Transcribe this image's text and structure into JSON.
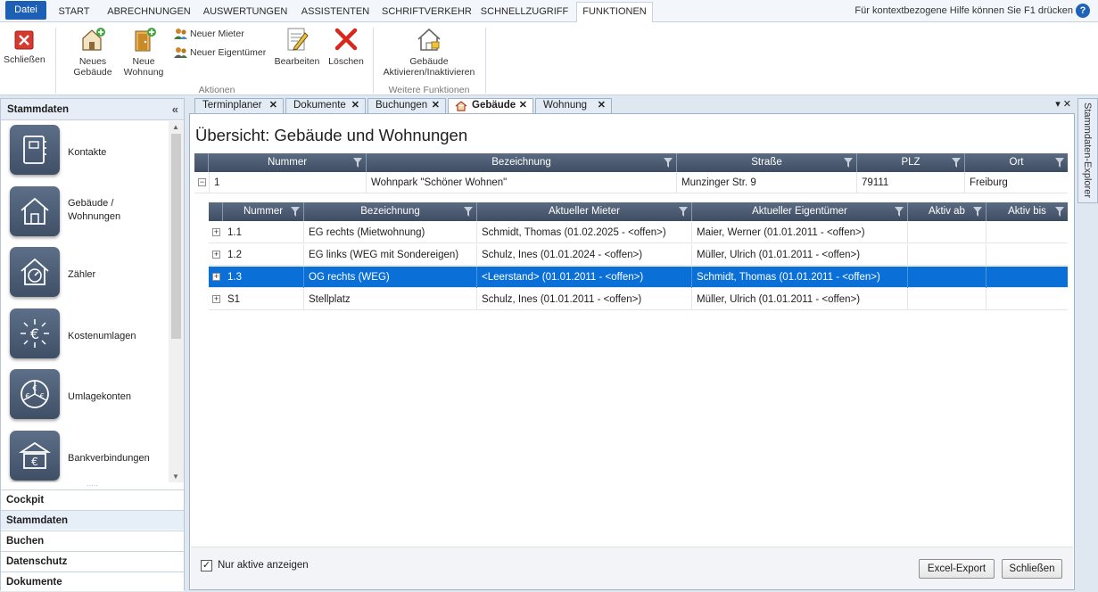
{
  "menu": {
    "tabs": [
      "Datei",
      "START",
      "ABRECHNUNGEN",
      "AUSWERTUNGEN",
      "ASSISTENTEN",
      "SCHRIFTVERKEHR",
      "SCHNELLZUGRIFF",
      "FUNKTIONEN"
    ],
    "active_tab": "FUNKTIONEN",
    "help_text": "Für kontextbezogene Hilfe können Sie F1 drücken",
    "help_icon": "help-icon"
  },
  "ribbon": {
    "close": "Schließen",
    "new_building": [
      "Neues",
      "Gebäude"
    ],
    "new_apartment": [
      "Neue",
      "Wohnung"
    ],
    "new_tenant": "Neuer Mieter",
    "new_owner": "Neuer Eigentümer",
    "edit": "Bearbeiten",
    "delete": "Löschen",
    "toggle_building": [
      "Gebäude",
      "Aktivieren/Inaktivieren"
    ],
    "group_actions": "Aktionen",
    "group_more": "Weitere Funktionen"
  },
  "sidebar": {
    "title": "Stammdaten",
    "items": [
      {
        "label": "Kontakte",
        "icon": "contacts-icon"
      },
      {
        "label": "Gebäude / Wohnungen",
        "icon": "house-icon"
      },
      {
        "label": "Zähler",
        "icon": "meter-icon"
      },
      {
        "label": "Kostenumlagen",
        "icon": "euro-distribution-icon"
      },
      {
        "label": "Umlagekonten",
        "icon": "euro-accounts-icon"
      },
      {
        "label": "Bankverbindungen",
        "icon": "bank-icon"
      }
    ],
    "nav": [
      "Cockpit",
      "Stammdaten",
      "Buchen",
      "Datenschutz",
      "Dokumente"
    ],
    "active_nav": "Stammdaten"
  },
  "tabs": [
    {
      "label": "Terminplaner"
    },
    {
      "label": "Dokumente"
    },
    {
      "label": "Buchungen"
    },
    {
      "label": "Gebäude",
      "active": true
    },
    {
      "label": "Wohnung"
    }
  ],
  "overview": {
    "title": "Übersicht: Gebäude und Wohnungen",
    "building_columns": [
      "Nummer",
      "Bezeichnung",
      "Straße",
      "PLZ",
      "Ort"
    ],
    "building": {
      "nummer": "1",
      "bezeichnung": "Wohnpark \"Schöner Wohnen\"",
      "strasse": "Munzinger Str. 9",
      "plz": "79111",
      "ort": "Freiburg"
    },
    "unit_columns": [
      "Nummer",
      "Bezeichnung",
      "Aktueller Mieter",
      "Aktueller Eigentümer",
      "Aktiv ab",
      "Aktiv bis"
    ],
    "units": [
      {
        "nummer": "1.1",
        "bezeichnung": "EG rechts (Mietwohnung)",
        "mieter": "Schmidt, Thomas (01.02.2025 - <offen>)",
        "eigentuemer": "Maier, Werner (01.01.2011 - <offen>)",
        "aktiv_ab": "",
        "aktiv_bis": ""
      },
      {
        "nummer": "1.2",
        "bezeichnung": "EG links (WEG mit Sondereigen)",
        "mieter": "Schulz, Ines (01.01.2024 - <offen>)",
        "eigentuemer": "Müller, Ulrich (01.01.2011 - <offen>)",
        "aktiv_ab": "",
        "aktiv_bis": ""
      },
      {
        "nummer": "1.3",
        "bezeichnung": "OG rechts (WEG)",
        "mieter": "<Leerstand> (01.01.2011 - <offen>)",
        "eigentuemer": "Schmidt, Thomas (01.01.2011 - <offen>)",
        "aktiv_ab": "",
        "aktiv_bis": "",
        "selected": true
      },
      {
        "nummer": "S1",
        "bezeichnung": "Stellplatz",
        "mieter": "Schulz, Ines (01.01.2011 - <offen>)",
        "eigentuemer": "Müller, Ulrich (01.01.2011 - <offen>)",
        "aktiv_ab": "",
        "aktiv_bis": ""
      }
    ],
    "only_active_label": "Nur aktive anzeigen",
    "only_active_checked": true,
    "excel_export": "Excel-Export",
    "close": "Schließen"
  },
  "explorer_label": "Stammdaten-Explorer",
  "colors": {
    "accent": "#1d5fb5",
    "selection": "#0a6fd6",
    "header": "#4a5a70"
  }
}
